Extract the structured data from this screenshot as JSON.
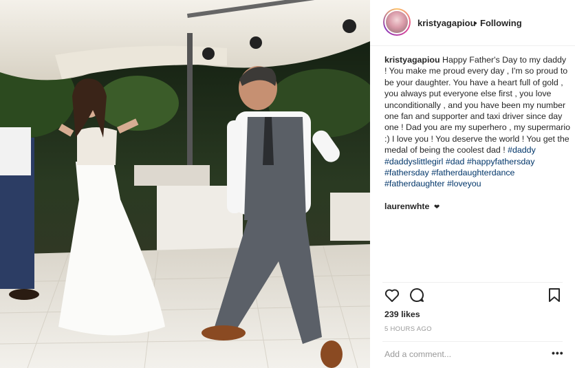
{
  "post": {
    "username": "kristyagapiou",
    "separator": "•",
    "follow_state": "Following",
    "caption_text": "Happy Father's Day to my daddy ! You make me proud every day , I'm so proud to be your daughter. You have a heart full of gold , you always put everyone else first , you love unconditionally , and you have been my number one fan and supporter and taxi driver since day one ! Dad you are my superhero , my supermario :) I love you ! You deserve the world ! You get the medal of being the coolest dad !",
    "hashtags": [
      "#daddy",
      "#daddyslittlegirl",
      "#dad",
      "#happyfathersday",
      "#fathersday",
      "#fatherdaughterdance",
      "#fatherdaughter",
      "#loveyou"
    ],
    "comments": [
      {
        "username": "laurenwhte",
        "text": "❤︎"
      }
    ],
    "likes_text": "239 likes",
    "time_text": "5 HOURS AGO",
    "add_comment_placeholder": "Add a comment...",
    "more_label": "•••"
  },
  "icons": {
    "like": "heart-icon",
    "comment": "comment-icon",
    "save": "bookmark-icon",
    "more": "more-options-icon"
  },
  "colors": {
    "text": "#262626",
    "link": "#003569",
    "muted": "#999999",
    "divider": "#efefef"
  }
}
